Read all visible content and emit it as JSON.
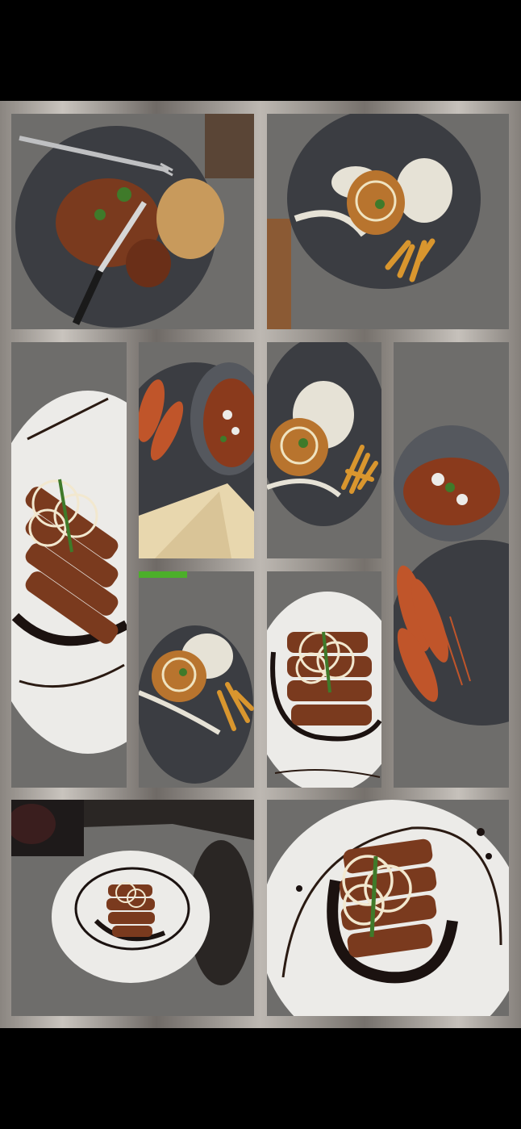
{
  "collage": {
    "tiles": [
      {
        "id": 1,
        "subject": "plated-meat-with-bread-and-knife"
      },
      {
        "id": 2,
        "subject": "plated-fish-with-sauce-and-fries"
      },
      {
        "id": 3,
        "subject": "sliced-steak-with-onion-rings"
      },
      {
        "id": 4,
        "subject": "prawns-with-curry-bowl-and-toast"
      },
      {
        "id": 5,
        "subject": "plated-fish-with-sauce-and-fries"
      },
      {
        "id": 6,
        "subject": "curry-bowl-with-grilled-prawns"
      },
      {
        "id": 7,
        "subject": "plated-fish-with-sauce-and-fries"
      },
      {
        "id": 8,
        "subject": "sliced-steak-with-onion-rings"
      },
      {
        "id": 9,
        "subject": "steak-plate-on-counter"
      },
      {
        "id": 10,
        "subject": "sliced-steak-with-balsamic-swirl"
      }
    ],
    "colors": {
      "background": "#000000",
      "frame": "#a9a49e",
      "countertop": "#6e6d6b",
      "dark_plate": "#3b3d42",
      "white_plate": "#ecebe8",
      "meat": "#7a3a1e",
      "sauce_cream": "#e6e2d6",
      "fries": "#d9962e",
      "balsamic": "#1b1210",
      "prawn": "#c0552a",
      "herb": "#3f7a2a"
    }
  }
}
